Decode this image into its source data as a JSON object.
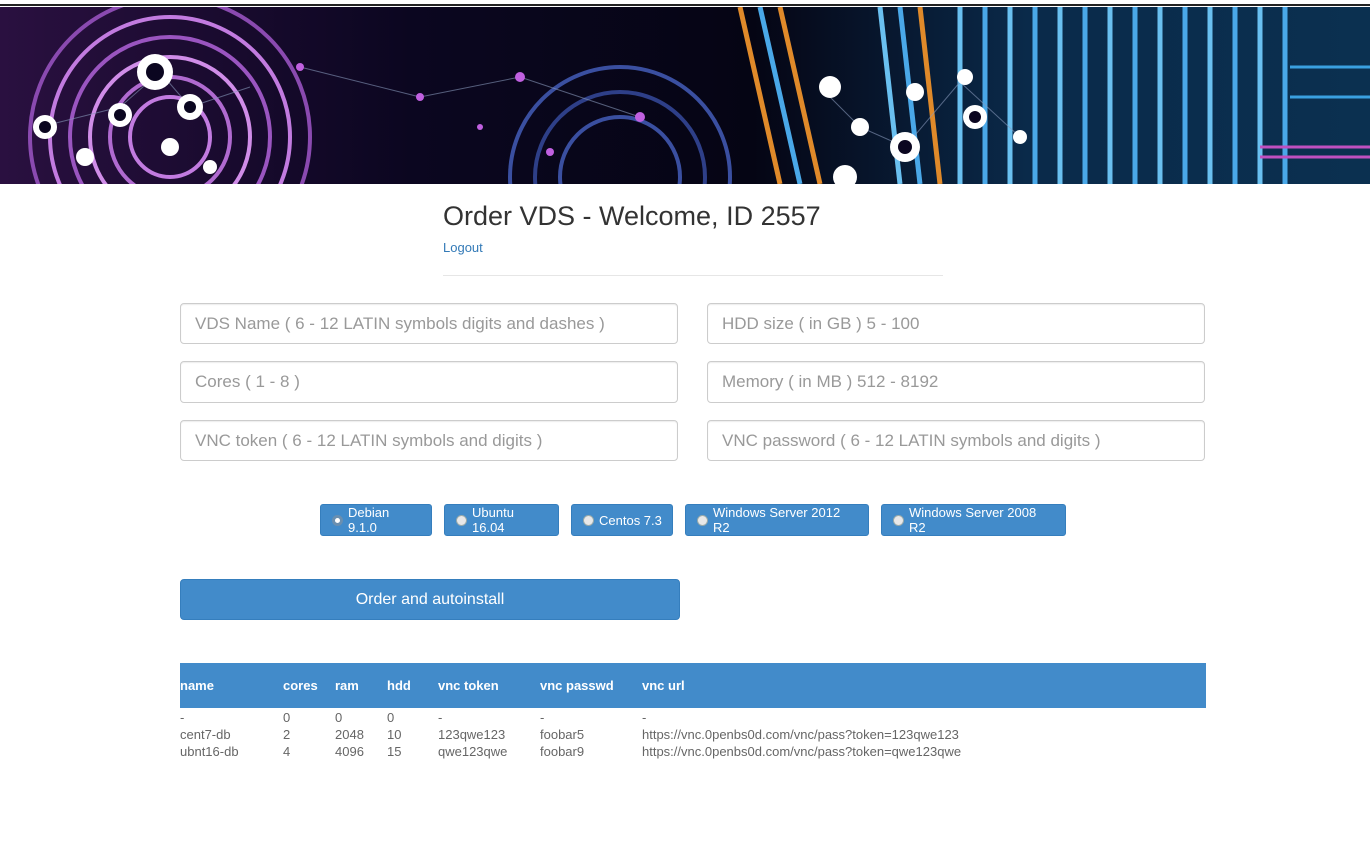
{
  "page": {
    "title": "Order VDS - Welcome, ID 2557",
    "logout_label": "Logout"
  },
  "form": {
    "vds_name_placeholder": "VDS Name ( 6 - 12 LATIN symbols digits and dashes )",
    "hdd_placeholder": "HDD size ( in GB ) 5 - 100",
    "cores_placeholder": "Cores ( 1 - 8 )",
    "memory_placeholder": "Memory ( in MB ) 512 - 8192",
    "vnc_token_placeholder": "VNC token ( 6 - 12 LATIN symbols and digits )",
    "vnc_password_placeholder": "VNC password ( 6 - 12 LATIN symbols and digits )"
  },
  "os_options": [
    {
      "label": "Debian 9.1.0",
      "checked": true
    },
    {
      "label": "Ubuntu 16.04",
      "checked": false
    },
    {
      "label": "Centos 7.3",
      "checked": false
    },
    {
      "label": "Windows Server 2012 R2",
      "checked": false
    },
    {
      "label": "Windows Server 2008 R2",
      "checked": false
    }
  ],
  "order_button_label": "Order and autoinstall",
  "table": {
    "headers": [
      "name",
      "cores",
      "ram",
      "hdd",
      "vnc token",
      "vnc passwd",
      "vnc url"
    ],
    "rows": [
      [
        "-",
        "0",
        "0",
        "0",
        "-",
        "-",
        "-"
      ],
      [
        "cent7-db",
        "2",
        "2048",
        "10",
        "123qwe123",
        "foobar5",
        "https://vnc.0penbs0d.com/vnc/pass?token=123qwe123"
      ],
      [
        "ubnt16-db",
        "4",
        "4096",
        "15",
        "qwe123qwe",
        "foobar9",
        "https://vnc.0penbs0d.com/vnc/pass?token=qwe123qwe"
      ]
    ]
  },
  "colors": {
    "accent": "#428bca",
    "link": "#337ab7"
  }
}
